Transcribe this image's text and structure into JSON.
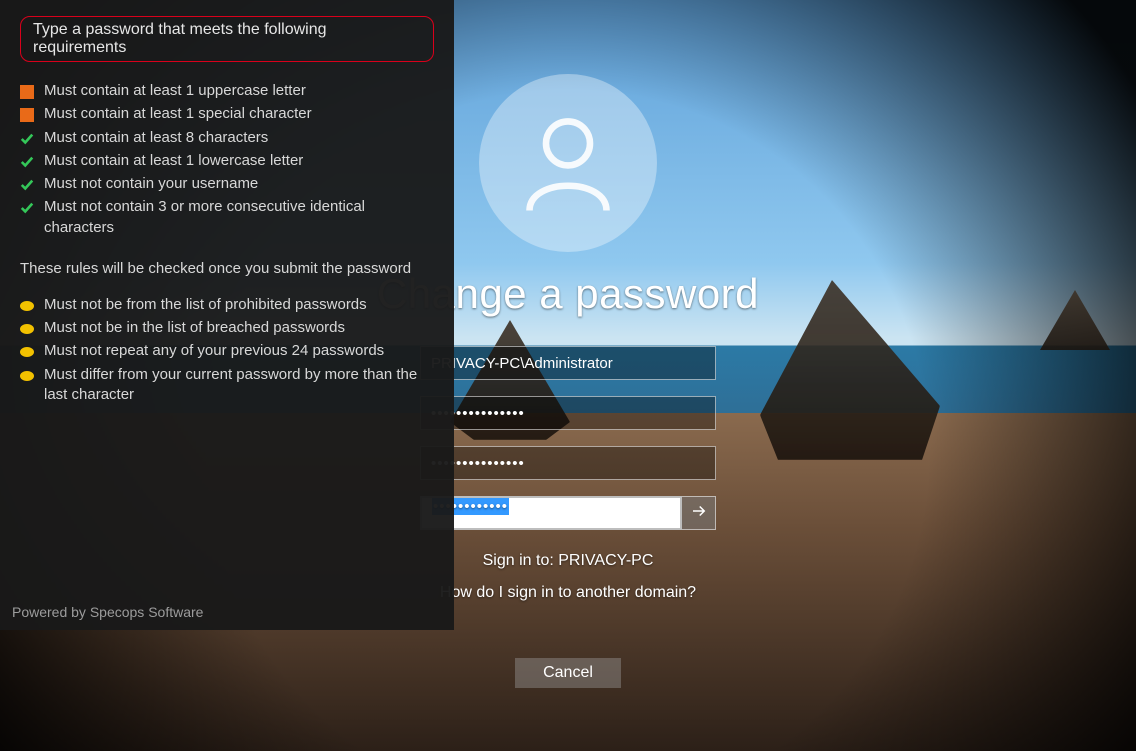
{
  "sidebar": {
    "header": "Type a password that meets the following requirements",
    "live_rules": [
      {
        "status": "fail",
        "text": "Must contain at least 1 uppercase letter"
      },
      {
        "status": "fail",
        "text": "Must contain at least 1 special character"
      },
      {
        "status": "pass",
        "text": "Must contain at least 8 characters"
      },
      {
        "status": "pass",
        "text": "Must contain at least 1 lowercase letter"
      },
      {
        "status": "pass",
        "text": "Must not contain your username"
      },
      {
        "status": "pass",
        "text": "Must not contain 3 or more consecutive identical characters"
      }
    ],
    "submit_note": "These rules will be checked once you submit the password",
    "submit_rules": [
      {
        "status": "pending",
        "text": "Must not be from the list of prohibited passwords"
      },
      {
        "status": "pending",
        "text": "Must not be in the list of breached passwords"
      },
      {
        "status": "pending",
        "text": "Must not repeat any of your previous 24 passwords"
      },
      {
        "status": "pending",
        "text": "Must differ from your current password by more than the last character"
      }
    ],
    "powered_by": "Powered by Specops Software"
  },
  "main": {
    "title": "Change a password",
    "username": "PRIVACY-PC\\Administrator",
    "old_password_mask": "•••••••••••••••",
    "new_password_mask": "•••••••••••••••",
    "confirm_password_mask": "••••••••••••",
    "sign_in_to_label": "Sign in to: ",
    "sign_in_to_value": "PRIVACY-PC",
    "other_domain": "How do I sign in to another domain?",
    "cancel": "Cancel"
  },
  "colors": {
    "fail": "#e96a18",
    "pass": "#34c759",
    "pending": "#f2c100",
    "header_border": "#d9001b"
  }
}
